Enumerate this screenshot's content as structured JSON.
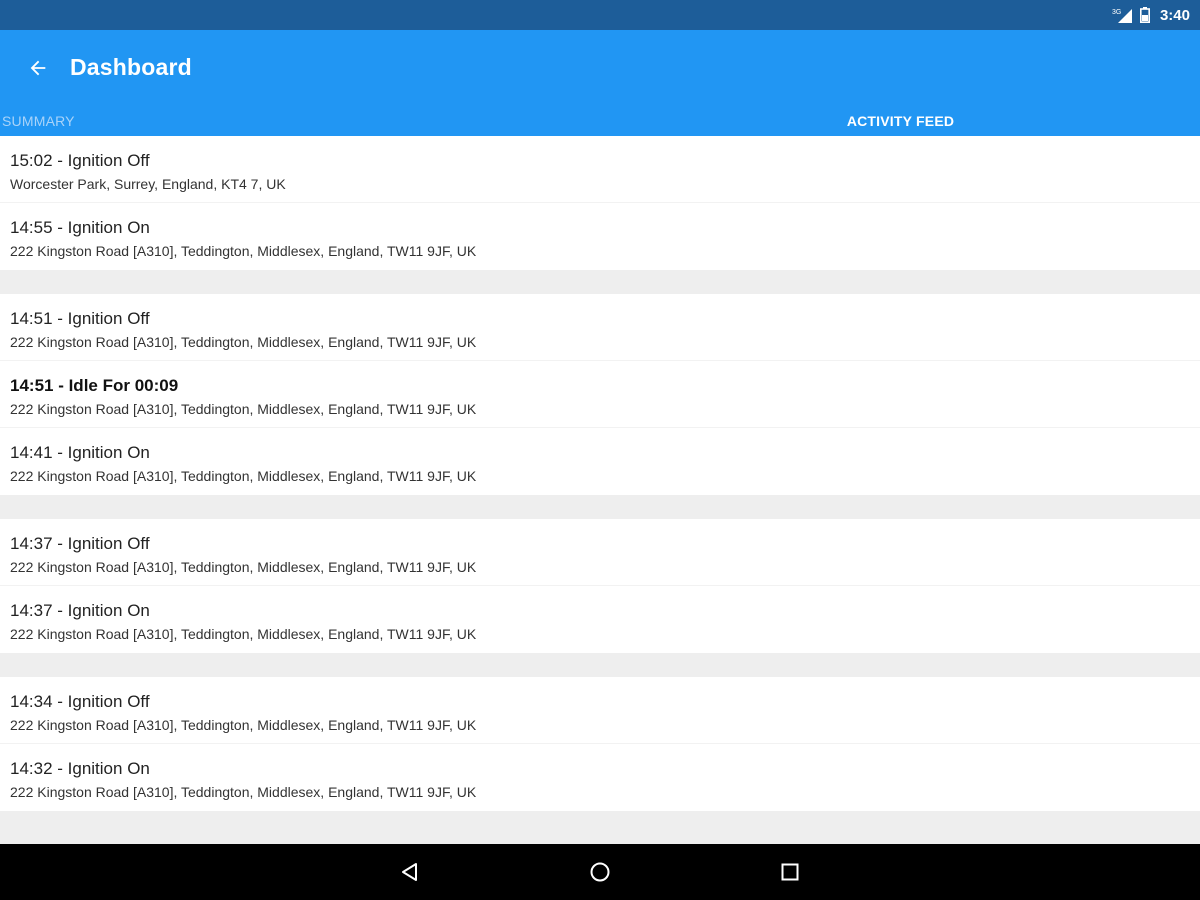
{
  "status_bar": {
    "time": "3:40",
    "icons": [
      "signal-icon",
      "battery-icon"
    ]
  },
  "app_bar": {
    "title": "Dashboard",
    "back_icon": "arrow-left-icon"
  },
  "tabs": [
    {
      "label": "SUMMARY",
      "active": false
    },
    {
      "label": "ACTIVITY FEED",
      "active": true
    }
  ],
  "feed": {
    "groups": [
      {
        "entries": [
          {
            "event": "15:02 - Ignition Off",
            "address": "Worcester Park, Surrey, England, KT4 7, UK",
            "bold": false
          },
          {
            "event": "14:55 - Ignition On",
            "address": "222 Kingston Road [A310], Teddington, Middlesex, England, TW11 9JF, UK",
            "bold": false
          }
        ]
      },
      {
        "entries": [
          {
            "event": "14:51 - Ignition Off",
            "address": "222 Kingston Road [A310], Teddington, Middlesex, England, TW11 9JF, UK",
            "bold": false
          },
          {
            "event": "14:51 - Idle For 00:09",
            "address": "222 Kingston Road [A310], Teddington, Middlesex, England, TW11 9JF, UK",
            "bold": true
          },
          {
            "event": "14:41 - Ignition On",
            "address": "222 Kingston Road [A310], Teddington, Middlesex, England, TW11 9JF, UK",
            "bold": false
          }
        ]
      },
      {
        "entries": [
          {
            "event": "14:37 - Ignition Off",
            "address": "222 Kingston Road [A310], Teddington, Middlesex, England, TW11 9JF, UK",
            "bold": false
          },
          {
            "event": "14:37 - Ignition On",
            "address": "222 Kingston Road [A310], Teddington, Middlesex, England, TW11 9JF, UK",
            "bold": false
          }
        ]
      },
      {
        "entries": [
          {
            "event": "14:34 - Ignition Off",
            "address": "222 Kingston Road [A310], Teddington, Middlesex, England, TW11 9JF, UK",
            "bold": false
          },
          {
            "event": "14:32 - Ignition On",
            "address": "222 Kingston Road [A310], Teddington, Middlesex, England, TW11 9JF, UK",
            "bold": false
          }
        ]
      }
    ]
  },
  "nav_bar": {
    "buttons": [
      "back-triangle-icon",
      "home-circle-icon",
      "recents-square-icon"
    ]
  },
  "colors": {
    "status_bar": "#1d5d99",
    "app_bar": "#2196f3",
    "inactive_tab": "#a9d3f9",
    "feed_background": "#eeeeee"
  }
}
